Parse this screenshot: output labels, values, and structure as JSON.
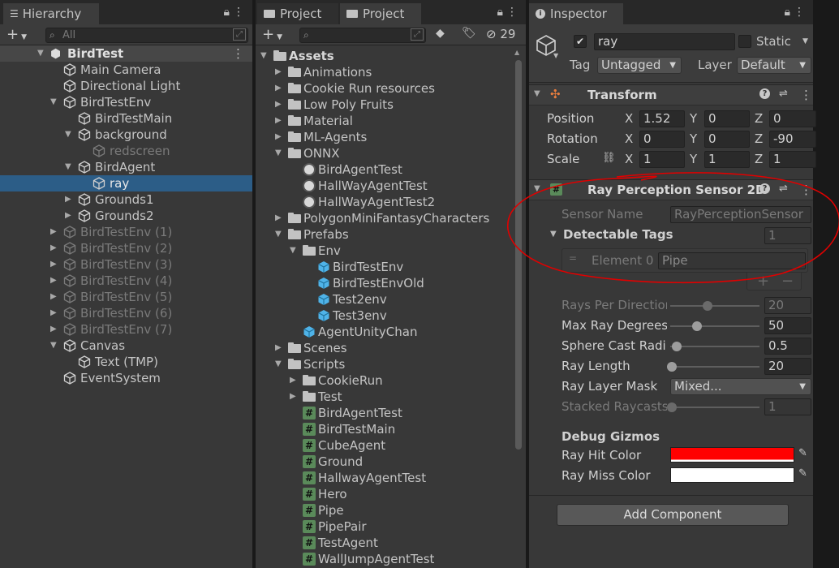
{
  "hierarchy": {
    "tab": "Hierarchy",
    "search_placeholder": "All",
    "scene": "BirdTest",
    "items": [
      {
        "label": "Main Camera"
      },
      {
        "label": "Directional Light"
      },
      {
        "label": "BirdTestEnv"
      },
      {
        "label": "BirdTestMain"
      },
      {
        "label": "background"
      },
      {
        "label": "redscreen"
      },
      {
        "label": "BirdAgent"
      },
      {
        "label": "ray"
      },
      {
        "label": "Grounds1"
      },
      {
        "label": "Grounds2"
      },
      {
        "label": "BirdTestEnv (1)"
      },
      {
        "label": "BirdTestEnv (2)"
      },
      {
        "label": "BirdTestEnv (3)"
      },
      {
        "label": "BirdTestEnv (4)"
      },
      {
        "label": "BirdTestEnv (5)"
      },
      {
        "label": "BirdTestEnv (6)"
      },
      {
        "label": "BirdTestEnv (7)"
      },
      {
        "label": "Canvas"
      },
      {
        "label": "Text (TMP)"
      },
      {
        "label": "EventSystem"
      }
    ]
  },
  "project": {
    "tab1": "Project",
    "tab2": "Project",
    "hidden_count": "29",
    "items": [
      {
        "label": "Assets"
      },
      {
        "label": "Animations"
      },
      {
        "label": "Cookie Run resources"
      },
      {
        "label": "Low Poly Fruits"
      },
      {
        "label": "Material"
      },
      {
        "label": "ML-Agents"
      },
      {
        "label": "ONNX"
      },
      {
        "label": "BirdAgentTest"
      },
      {
        "label": "HallWayAgentTest"
      },
      {
        "label": "HallWayAgentTest2"
      },
      {
        "label": "PolygonMiniFantasyCharacters"
      },
      {
        "label": "Prefabs"
      },
      {
        "label": "Env"
      },
      {
        "label": "BirdTestEnv"
      },
      {
        "label": "BirdTestEnvOld"
      },
      {
        "label": "Test2env"
      },
      {
        "label": "Test3env"
      },
      {
        "label": "AgentUnityChan"
      },
      {
        "label": "Scenes"
      },
      {
        "label": "Scripts"
      },
      {
        "label": "CookieRun"
      },
      {
        "label": "Test"
      },
      {
        "label": "BirdAgentTest"
      },
      {
        "label": "BirdTestMain"
      },
      {
        "label": "CubeAgent"
      },
      {
        "label": "Ground"
      },
      {
        "label": "HallwayAgentTest"
      },
      {
        "label": "Hero"
      },
      {
        "label": "Pipe"
      },
      {
        "label": "PipePair"
      },
      {
        "label": "TestAgent"
      },
      {
        "label": "WallJumpAgentTest"
      }
    ]
  },
  "inspector": {
    "tab": "Inspector",
    "object_name": "ray",
    "static_label": "Static",
    "tag_label": "Tag",
    "tag_value": "Untagged",
    "layer_label": "Layer",
    "layer_value": "Default",
    "transform": {
      "title": "Transform",
      "position_label": "Position",
      "rotation_label": "Rotation",
      "scale_label": "Scale",
      "x": "X",
      "y": "Y",
      "z": "Z",
      "position": [
        "1.52",
        "0",
        "0"
      ],
      "rotation": [
        "0",
        "0",
        "-90"
      ],
      "scale": [
        "1",
        "1",
        "1"
      ]
    },
    "ray_sensor": {
      "title": "Ray Perception Sensor 2D",
      "sensor_name_label": "Sensor Name",
      "sensor_name_value": "RayPerceptionSensor",
      "detectable_tags_label": "Detectable Tags",
      "detectable_tags_count": "1",
      "element0_label": "Element 0",
      "element0_value": "Pipe",
      "add": "+",
      "remove": "−",
      "rays_per_direction_label": "Rays Per Directior",
      "rays_per_direction_value": "20",
      "max_ray_degrees_label": "Max Ray Degrees",
      "max_ray_degrees_value": "50",
      "sphere_cast_radius_label": "Sphere Cast Radiu",
      "sphere_cast_radius_value": "0.5",
      "ray_length_label": "Ray Length",
      "ray_length_value": "20",
      "ray_layer_mask_label": "Ray Layer Mask",
      "ray_layer_mask_value": "Mixed...",
      "stacked_raycasts_label": "Stacked Raycasts",
      "stacked_raycasts_value": "1",
      "debug_gizmos_label": "Debug Gizmos",
      "ray_hit_color_label": "Ray Hit Color",
      "ray_miss_color_label": "Ray Miss Color",
      "ray_hit_color": "#ff0000",
      "ray_miss_color": "#ffffff"
    },
    "add_component": "Add Component"
  },
  "colors": {
    "selection": "#2c5d87",
    "annotation": "#e00000"
  }
}
